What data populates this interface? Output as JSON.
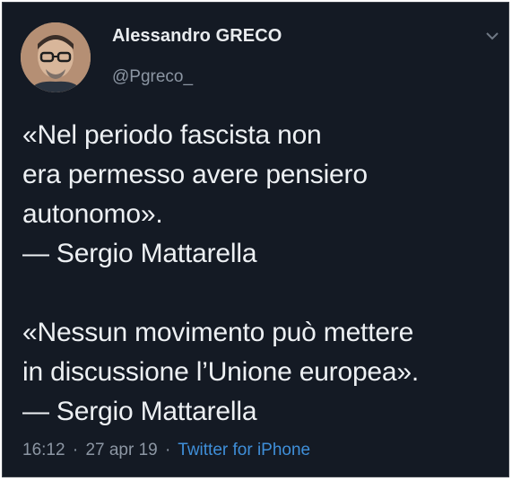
{
  "tweet": {
    "user": {
      "name": "Alessandro GRECO",
      "handle": "@Pgreco_"
    },
    "icons": {
      "menu": "chevron-down-icon",
      "avatar": "avatar-photo"
    },
    "quote_1": {
      "lines": [
        "«Nel periodo fascista non",
        "era permesso avere pensiero",
        "autonomo».",
        "— Sergio Mattarella"
      ]
    },
    "quote_2": {
      "lines": [
        "«Nessun movimento può mettere",
        "in discussione l’Unione europea».",
        "— Sergio Mattarella"
      ]
    },
    "meta": {
      "time": "16:12",
      "separator_1": "·",
      "date": "27 apr 19",
      "separator_2": "·",
      "source": "Twitter for iPhone"
    }
  },
  "colors": {
    "background": "#141a24",
    "text": "#edf0f3",
    "muted": "#8c96a3",
    "link": "#3f8fd9"
  }
}
